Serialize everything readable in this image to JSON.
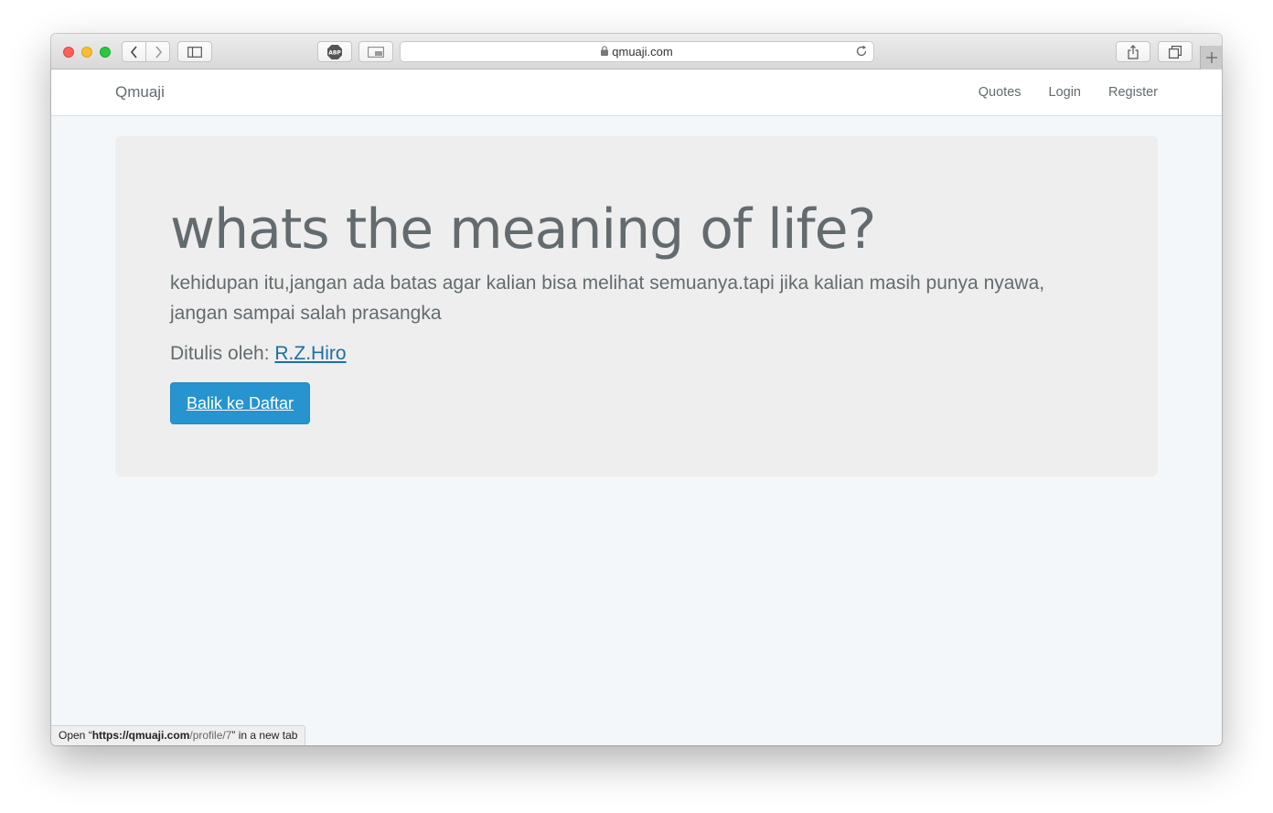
{
  "browser": {
    "url": "qmuaji.com",
    "status": {
      "prefix": "Open “",
      "host": "https://qmuaji.com",
      "path": "/profile/7",
      "suffix": "” in a new tab"
    },
    "icons": [
      "back-icon",
      "forward-icon",
      "sidebar-icon",
      "adblock-icon",
      "pip-icon",
      "lock-icon",
      "reload-icon",
      "share-icon",
      "tabs-icon",
      "plus-icon"
    ],
    "adblock_label": "ABP"
  },
  "navbar": {
    "brand": "Qmuaji",
    "links": [
      {
        "label": "Quotes"
      },
      {
        "label": "Login"
      },
      {
        "label": "Register"
      }
    ]
  },
  "quote": {
    "title": "whats the meaning of life?",
    "body": "kehidupan itu,jangan ada batas agar kalian bisa melihat semuanya.tapi jika kalian masih punya nyawa, jangan sampai salah prasangka",
    "author_prefix": "Ditulis oleh: ",
    "author": "R.Z.Hiro",
    "back_button": "Balik ke Daftar"
  },
  "colors": {
    "text": "#636b6f",
    "button": "#2794cf",
    "link": "#1f6ea3",
    "page_bg": "#f3f7fa",
    "jumbotron_bg": "#eeeeee"
  }
}
